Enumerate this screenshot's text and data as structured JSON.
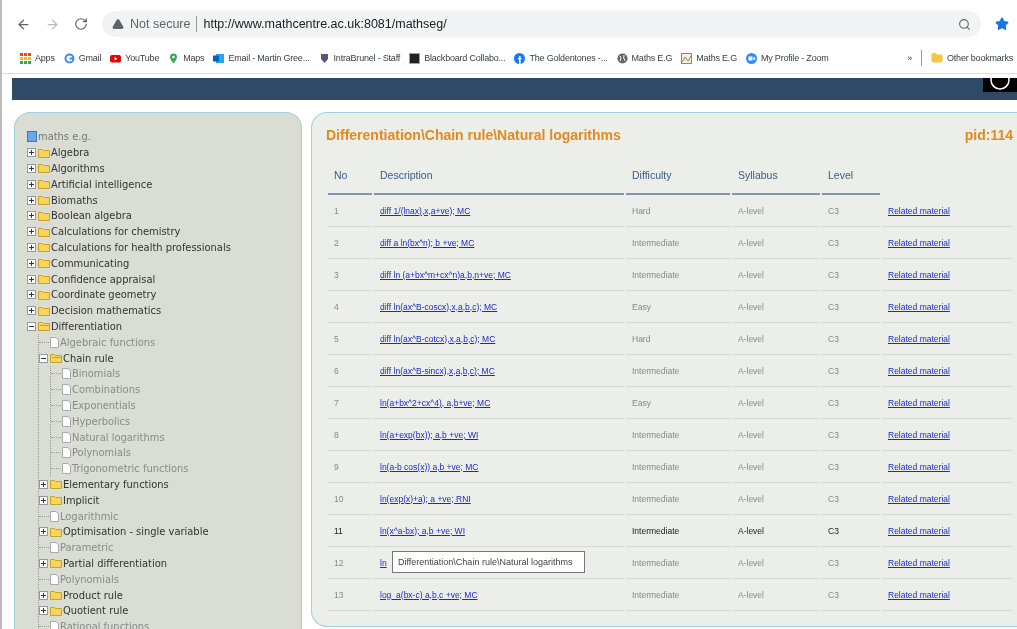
{
  "browser": {
    "security": "Not secure",
    "url": "http://www.mathcentre.ac.uk:8081/mathseg/",
    "bookmarks": [
      {
        "label": "Apps",
        "kind": "apps"
      },
      {
        "label": "Gmail",
        "kind": "google"
      },
      {
        "label": "YouTube",
        "kind": "youtube"
      },
      {
        "label": "Maps",
        "kind": "pin"
      },
      {
        "label": "Email - Martin Gree...",
        "kind": "mail"
      },
      {
        "label": "IntraBrunel - Staff",
        "kind": "crest"
      },
      {
        "label": "Blackboard Collabo...",
        "kind": "board"
      },
      {
        "label": "The Goldentones -...",
        "kind": "facebook"
      },
      {
        "label": "Maths E.G",
        "kind": "globe"
      },
      {
        "label": "Maths E.G",
        "kind": "image"
      },
      {
        "label": "My Profile - Zoom",
        "kind": "video"
      }
    ],
    "overflow": "»",
    "other_bookmarks": "Other bookmarks"
  },
  "tree": {
    "label": "maths e.g.",
    "children": [
      {
        "label": "Algebra",
        "kind": "folder",
        "expanded": false
      },
      {
        "label": "Algorithms",
        "kind": "folder",
        "expanded": false
      },
      {
        "label": "Artificial intelligence",
        "kind": "folder",
        "expanded": false
      },
      {
        "label": "Biomaths",
        "kind": "folder",
        "expanded": false
      },
      {
        "label": "Boolean algebra",
        "kind": "folder",
        "expanded": false
      },
      {
        "label": "Calculations for chemistry",
        "kind": "folder",
        "expanded": false
      },
      {
        "label": "Calculations for health professionals",
        "kind": "folder",
        "expanded": false
      },
      {
        "label": "Communicating",
        "kind": "folder",
        "expanded": false
      },
      {
        "label": "Confidence appraisal",
        "kind": "folder",
        "expanded": false
      },
      {
        "label": "Coordinate geometry",
        "kind": "folder",
        "expanded": false
      },
      {
        "label": "Decision mathematics",
        "kind": "folder",
        "expanded": false
      },
      {
        "label": "Differentiation",
        "kind": "folder",
        "expanded": true,
        "children": [
          {
            "label": "Algebraic functions",
            "kind": "page"
          },
          {
            "label": "Chain rule",
            "kind": "folder",
            "expanded": true,
            "children": [
              {
                "label": "Binomials",
                "kind": "page"
              },
              {
                "label": "Combinations",
                "kind": "page"
              },
              {
                "label": "Exponentials",
                "kind": "page"
              },
              {
                "label": "Hyperbolics",
                "kind": "page"
              },
              {
                "label": "Natural logarithms",
                "kind": "page"
              },
              {
                "label": "Polynomials",
                "kind": "page"
              },
              {
                "label": "Trigonometric functions",
                "kind": "page"
              }
            ]
          },
          {
            "label": "Elementary functions",
            "kind": "folder",
            "expanded": false
          },
          {
            "label": "Implicit",
            "kind": "folder",
            "expanded": false
          },
          {
            "label": "Logarithmic",
            "kind": "page"
          },
          {
            "label": "Optimisation - single variable",
            "kind": "folder",
            "expanded": false
          },
          {
            "label": "Parametric",
            "kind": "page"
          },
          {
            "label": "Partial differentiation",
            "kind": "folder",
            "expanded": false
          },
          {
            "label": "Polynomials",
            "kind": "page"
          },
          {
            "label": "Product rule",
            "kind": "folder",
            "expanded": false
          },
          {
            "label": "Quotient rule",
            "kind": "folder",
            "expanded": false
          },
          {
            "label": "Rational functions",
            "kind": "page"
          }
        ]
      }
    ]
  },
  "content": {
    "title": "Differentiation\\Chain rule\\Natural logarithms",
    "pid": "pid:114",
    "columns": [
      "No",
      "Description",
      "Difficulty",
      "Syllabus",
      "Level"
    ],
    "rows": [
      {
        "no": "1",
        "description": "diff 1/(lnax),x,a+ve); MC",
        "difficulty": "Hard",
        "syllabus": "A-level",
        "level": "C3",
        "link": "Related material",
        "hovered": false
      },
      {
        "no": "2",
        "description": "diff a ln(bx^n); b +ve; MC",
        "difficulty": "Intermediate",
        "syllabus": "A-level",
        "level": "C3",
        "link": "Related material",
        "hovered": false
      },
      {
        "no": "3",
        "description": "diff ln (a+bx^m+cx^n)a,b,n+ve; MC",
        "difficulty": "Intermediate",
        "syllabus": "A-level",
        "level": "C3",
        "link": "Related material",
        "hovered": false
      },
      {
        "no": "4",
        "description": "diff ln(ax^B-coscx),x,a,b,c); MC",
        "difficulty": "Easy",
        "syllabus": "A-level",
        "level": "C3",
        "link": "Related material",
        "hovered": false
      },
      {
        "no": "5",
        "description": "diff ln(ax^B-cotcx),x,a,b,c); MC",
        "difficulty": "Hard",
        "syllabus": "A-level",
        "level": "C3",
        "link": "Related material",
        "hovered": false
      },
      {
        "no": "6",
        "description": "diff ln(ax^B-sincx),x,a,b,c); MC",
        "difficulty": "Intermediate",
        "syllabus": "A-level",
        "level": "C3",
        "link": "Related material",
        "hovered": false
      },
      {
        "no": "7",
        "description": "ln(a+bx^2+cx^4), a,b+ve; MC",
        "difficulty": "Easy",
        "syllabus": "A-level",
        "level": "C3",
        "link": "Related material",
        "hovered": false
      },
      {
        "no": "8",
        "description": "ln(a+exp(bx)); a,b +ve; WI",
        "difficulty": "Intermediate",
        "syllabus": "A-level",
        "level": "C3",
        "link": "Related material",
        "hovered": false
      },
      {
        "no": "9",
        "description": "ln(a-b cos(x)) a,b +ve; MC",
        "difficulty": "Intermediate",
        "syllabus": "A-level",
        "level": "C3",
        "link": "Related material",
        "hovered": false
      },
      {
        "no": "10",
        "description": "ln(exp(x)+a); a +ve; RNI",
        "difficulty": "Intermediate",
        "syllabus": "A-level",
        "level": "C3",
        "link": "Related material",
        "hovered": false
      },
      {
        "no": "11",
        "description": "ln(x^a-bx); a,b +ve; WI",
        "difficulty": "Intermediate",
        "syllabus": "A-level",
        "level": "C3",
        "link": "Related material",
        "hovered": true
      },
      {
        "no": "12",
        "description": "ln",
        "difficulty": "Intermediate",
        "syllabus": "A-level",
        "level": "C3",
        "link": "Related material",
        "hovered": false
      },
      {
        "no": "13",
        "description": "log_a(bx-c) a,b,c +ve; MC",
        "difficulty": "Intermediate",
        "syllabus": "A-level",
        "level": "C3",
        "link": "Related material",
        "hovered": false
      }
    ],
    "tooltip": "Differentiation\\Chain rule\\Natural logarithms"
  }
}
